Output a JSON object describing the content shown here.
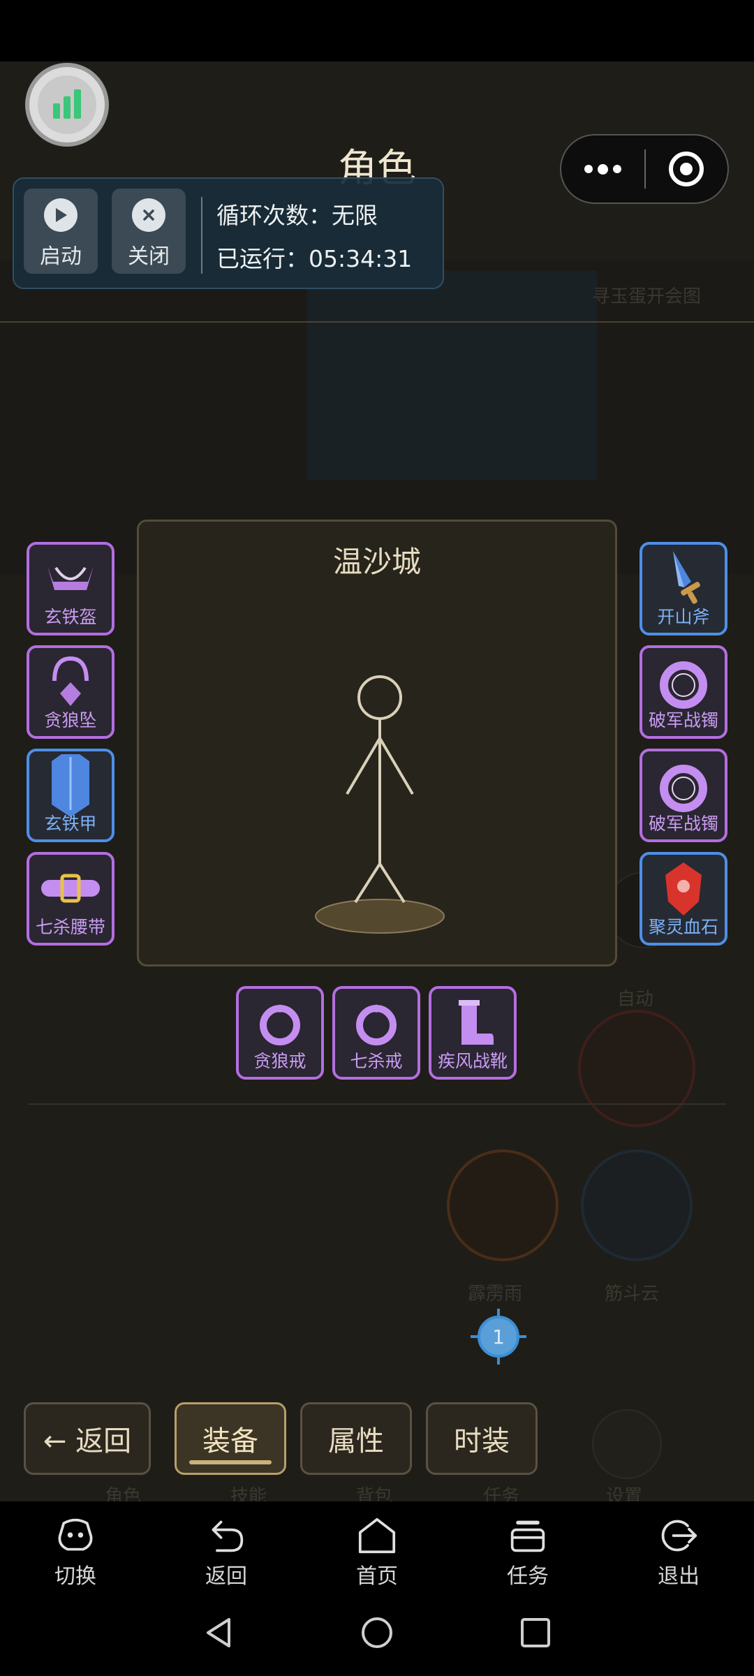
{
  "page": {
    "title": "角色"
  },
  "background": {
    "ghost_top_right": "寻玉蛋开会图",
    "ghost_auto": "自动",
    "ghost_skill1": "霹雳雨",
    "ghost_skill2": "筋斗云",
    "ghost_bottom_left": "角色",
    "ghost_bottom_2": "技能",
    "ghost_bottom_3": "背包",
    "ghost_bottom_4": "任务",
    "ghost_settings": "设置"
  },
  "script_panel": {
    "start_label": "启动",
    "close_label": "关闭",
    "loop_text": "循环次数：无限",
    "runtime_text": "已运行：05:34:31"
  },
  "equipment": {
    "map_name": "温沙城",
    "left_slots": [
      {
        "name": "玄铁盔",
        "icon": "helmet-icon",
        "rarity": "purple"
      },
      {
        "name": "贪狼坠",
        "icon": "necklace-icon",
        "rarity": "purple"
      },
      {
        "name": "玄铁甲",
        "icon": "armor-icon",
        "rarity": "blue"
      },
      {
        "name": "七杀腰带",
        "icon": "belt-icon",
        "rarity": "purple"
      }
    ],
    "right_slots": [
      {
        "name": "开山斧",
        "icon": "weapon-icon",
        "rarity": "blue"
      },
      {
        "name": "破军战镯",
        "icon": "bracelet-icon",
        "rarity": "purple"
      },
      {
        "name": "破军战镯",
        "icon": "bracelet-icon",
        "rarity": "purple"
      },
      {
        "name": "聚灵血石",
        "icon": "gem-icon",
        "rarity": "blue"
      }
    ],
    "bottom_slots": [
      {
        "name": "贪狼戒",
        "icon": "ring-icon",
        "rarity": "purple"
      },
      {
        "name": "七杀戒",
        "icon": "ring-icon",
        "rarity": "purple"
      },
      {
        "name": "疾风战靴",
        "icon": "boots-icon",
        "rarity": "purple"
      }
    ]
  },
  "locate_badge": "1",
  "tabs": {
    "back": "← 返回",
    "equip": "装备",
    "attr": "属性",
    "fashion": "时装",
    "active": "装备"
  },
  "nav_bar": {
    "items": [
      {
        "label": "切换",
        "icon": "switch-icon"
      },
      {
        "label": "返回",
        "icon": "back-arrow-icon"
      },
      {
        "label": "首页",
        "icon": "home-icon"
      },
      {
        "label": "任务",
        "icon": "task-icon"
      },
      {
        "label": "退出",
        "icon": "exit-icon"
      }
    ]
  },
  "colors": {
    "purple_border": "#b36ee0",
    "blue_border": "#4e8fe8",
    "app_bg": "#1f1d18",
    "accent_gold": "#c9b27a"
  }
}
